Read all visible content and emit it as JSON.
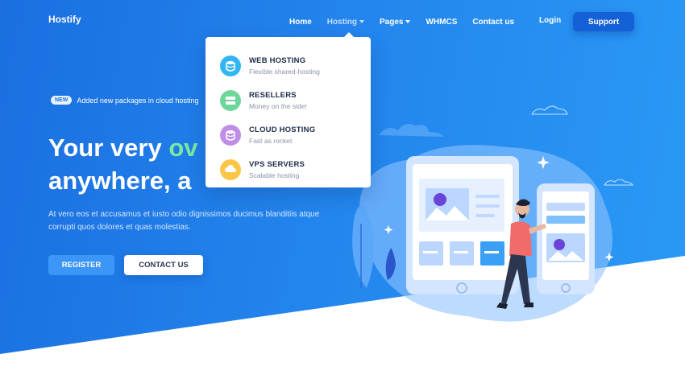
{
  "brand": "Hostify",
  "nav": {
    "home": "Home",
    "hosting": "Hosting",
    "pages": "Pages",
    "whmcs": "WHMCS",
    "contact": "Contact us",
    "login": "Login",
    "support": "Support"
  },
  "announcement": {
    "badge": "NEW",
    "text": "Added new packages in cloud hosting"
  },
  "hero": {
    "headline_line1_a": "Your very ",
    "headline_line1_b": "ov",
    "headline_line2": "anywhere, a",
    "description": "At vero eos et accusamus et iusto odio dignissimos ducimus blanditiis atque corrupti quos dolores et quas molestias.",
    "register": "REGISTER",
    "contact": "CONTACT US"
  },
  "dropdown": {
    "items": [
      {
        "title": "WEB HOSTING",
        "subtitle": "Flexible shared-hosting",
        "icon": "server-icon",
        "color": "#31b6f2"
      },
      {
        "title": "RESELLERS",
        "subtitle": "Money on the side!",
        "icon": "reseller-icon",
        "color": "#6fd69b"
      },
      {
        "title": "CLOUD HOSTING",
        "subtitle": "Fast as rocket",
        "icon": "cloud-icon",
        "color": "#c08ee6"
      },
      {
        "title": "VPS SERVERS",
        "subtitle": "Scalable hosting",
        "icon": "vps-icon",
        "color": "#fbc648"
      }
    ]
  },
  "colors": {
    "hero_start": "#1b6fe0",
    "hero_end": "#2a9af5",
    "accent_green": "#7be8a4",
    "support_button": "#1460d6"
  }
}
